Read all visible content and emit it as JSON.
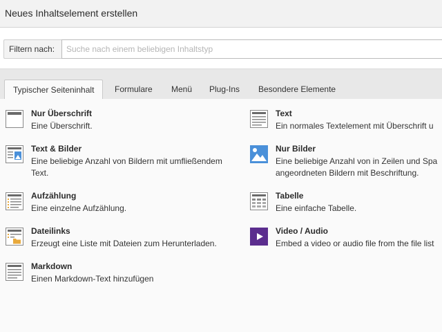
{
  "dialog": {
    "title": "Neues Inhaltselement erstellen"
  },
  "filter": {
    "label": "Filtern nach:",
    "placeholder": "Suche nach einem beliebigen Inhaltstyp",
    "value": ""
  },
  "tabs": [
    {
      "label": "Typischer Seiteninhalt",
      "active": true
    },
    {
      "label": "Formulare",
      "active": false
    },
    {
      "label": "Menü",
      "active": false
    },
    {
      "label": "Plug-Ins",
      "active": false
    },
    {
      "label": "Besondere Elemente",
      "active": false
    }
  ],
  "items": [
    {
      "title": "Nur Überschrift",
      "desc_line1": "Eine Überschrift.",
      "icon": "header-only-icon"
    },
    {
      "title": "Text",
      "desc_line1": "Ein normales Textelement mit Überschrift u",
      "icon": "text-icon"
    },
    {
      "title": "Text & Bilder",
      "desc_line1": "Eine beliebige Anzahl von Bildern mit umfließendem",
      "desc_line2": "Text.",
      "icon": "text-images-icon"
    },
    {
      "title": "Nur Bilder",
      "desc_line1": "Eine beliebige Anzahl von in Zeilen und Spa",
      "desc_line2": "angeordneten Bildern mit Beschriftung.",
      "icon": "images-only-icon"
    },
    {
      "title": "Aufzählung",
      "desc_line1": "Eine einzelne Aufzählung.",
      "icon": "bullet-list-icon"
    },
    {
      "title": "Tabelle",
      "desc_line1": "Eine einfache Tabelle.",
      "icon": "table-icon"
    },
    {
      "title": "Dateilinks",
      "desc_line1": "Erzeugt eine Liste mit Dateien zum Herunterladen.",
      "icon": "file-links-icon"
    },
    {
      "title": "Video / Audio",
      "desc_line1": "Embed a video or audio file from the file list",
      "icon": "video-audio-icon"
    },
    {
      "title": "Markdown",
      "desc_line1": "Einen Markdown-Text hinzufügen",
      "icon": "markdown-icon"
    }
  ],
  "colors": {
    "video_icon_bg": "#5b2d8e",
    "image_icon_blue": "#4a90d9",
    "list_icon_orange": "#e8a93c"
  }
}
